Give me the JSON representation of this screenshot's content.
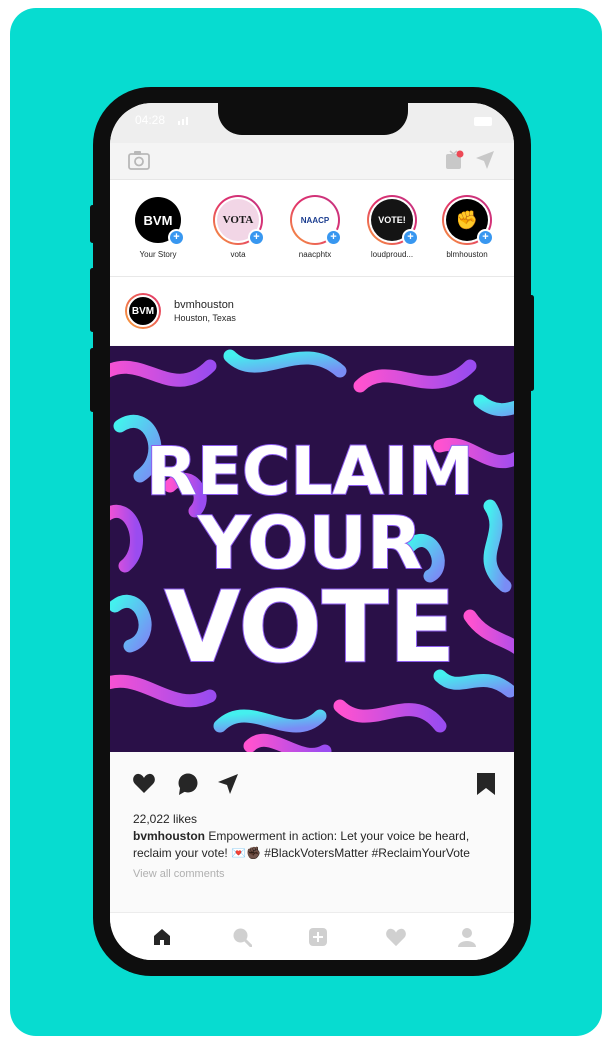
{
  "status_bar": {
    "time": "04:28"
  },
  "stories": [
    {
      "label": "Your Story",
      "avatar_text": "BVM",
      "avatar_bg": "#000000",
      "avatar_fg": "#ffffff",
      "ring": false
    },
    {
      "label": "vota",
      "avatar_text": "VOTA",
      "avatar_bg": "#f2d6e6",
      "avatar_fg": "#1a1a1a",
      "ring": true
    },
    {
      "label": "naacphtx",
      "avatar_text": "NAACP",
      "avatar_bg": "#ffffff",
      "avatar_fg": "#1b3d8f",
      "ring": true
    },
    {
      "label": "loudproud...",
      "avatar_text": "VOTE!",
      "avatar_bg": "#141414",
      "avatar_fg": "#ffffff",
      "ring": true
    },
    {
      "label": "blmhouston",
      "avatar_text": "✊",
      "avatar_bg": "#000000",
      "avatar_fg": "#ffffff",
      "ring": true
    }
  ],
  "post": {
    "username": "bvmhouston",
    "location": "Houston, Texas",
    "avatar_text": "BVM",
    "image_text": [
      "RECLAIM",
      "YOUR",
      "VOTE"
    ],
    "likes": "22,022 likes",
    "caption_user": "bvmhouston",
    "caption_text": "Empowerment in action: Let your voice be heard, reclaim your vote! 💌✊🏿 #BlackVotersMatter #ReclaimYourVote",
    "view_comments": "View all comments"
  },
  "icons": {
    "camera": "camera-icon",
    "igtv": "igtv-icon",
    "direct": "direct-message-icon",
    "like": "heart-icon",
    "comment": "comment-icon",
    "share": "share-icon",
    "save": "bookmark-icon",
    "tabs": [
      "home-icon",
      "search-icon",
      "add-post-icon",
      "activity-heart-icon",
      "profile-icon"
    ]
  },
  "colors": {
    "background": "#07dcd0",
    "phone": "#0e0e0e",
    "story_badge": "#3897f0",
    "image_bg": "#2a1048",
    "swirl_pink": "#e84fd8",
    "swirl_cyan": "#3fe3ea"
  }
}
